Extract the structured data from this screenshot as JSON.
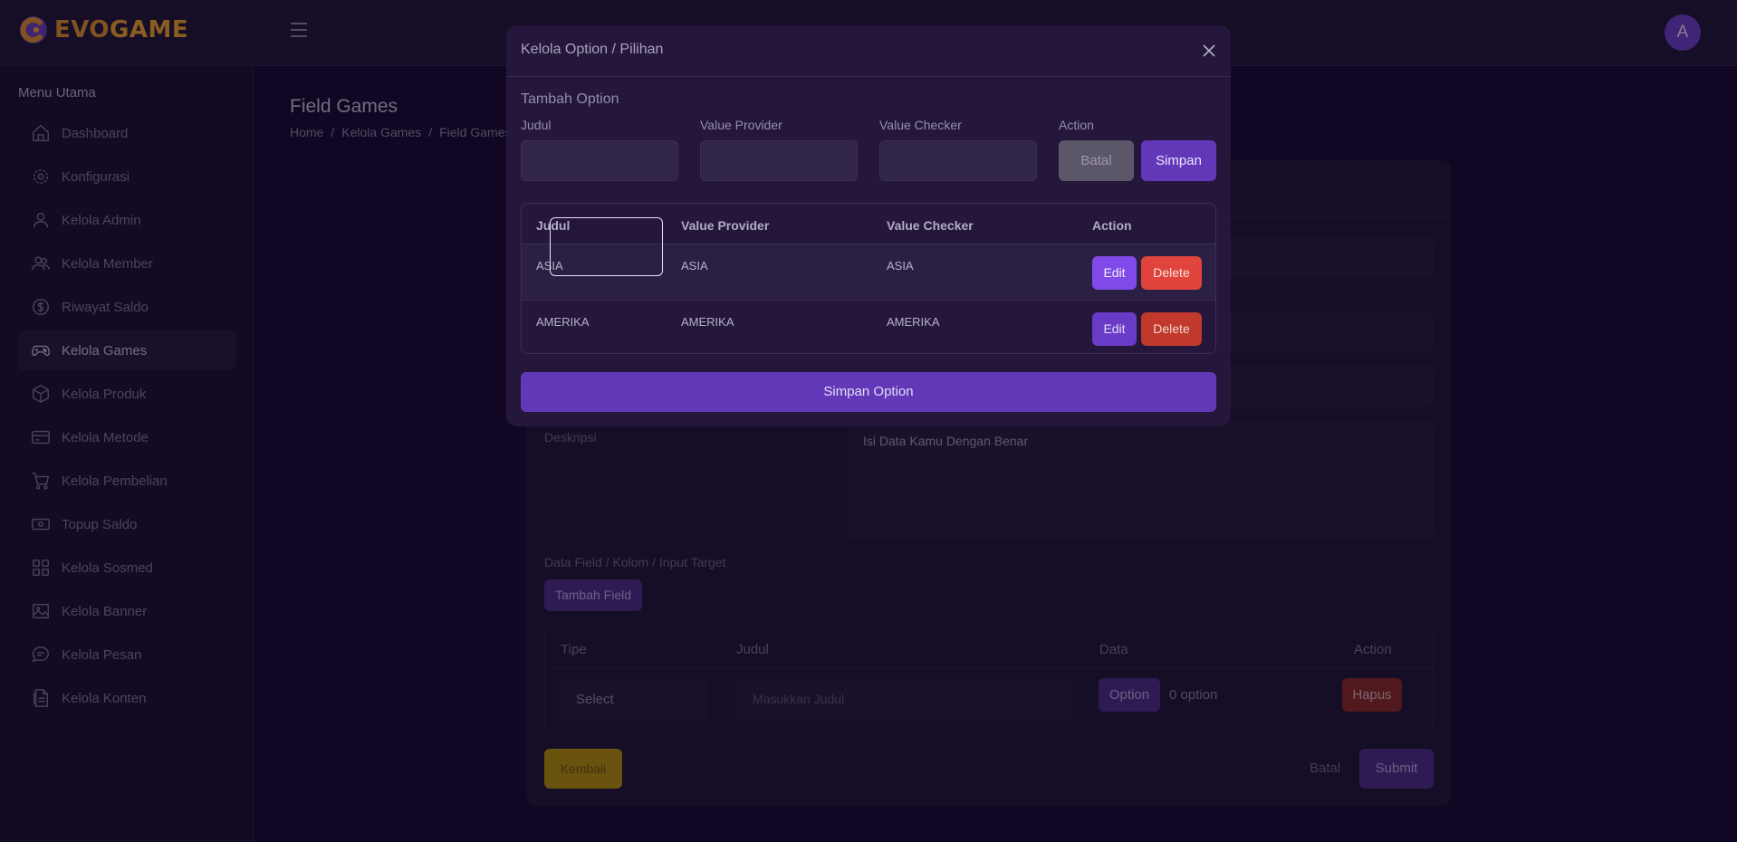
{
  "header": {
    "logo_evo": "EVO",
    "logo_game": "GAME",
    "avatar_initial": "A"
  },
  "sidebar": {
    "title": "Menu Utama",
    "items": [
      {
        "label": "Dashboard",
        "icon": "home-icon"
      },
      {
        "label": "Konfigurasi",
        "icon": "gear-icon"
      },
      {
        "label": "Kelola Admin",
        "icon": "user-icon"
      },
      {
        "label": "Kelola Member",
        "icon": "users-icon"
      },
      {
        "label": "Riwayat Saldo",
        "icon": "dollar-circle-icon"
      },
      {
        "label": "Kelola Games",
        "icon": "gamepad-icon",
        "active": true
      },
      {
        "label": "Kelola Produk",
        "icon": "box-icon"
      },
      {
        "label": "Kelola Metode",
        "icon": "card-icon"
      },
      {
        "label": "Kelola Pembelian",
        "icon": "cart-icon"
      },
      {
        "label": "Topup Saldo",
        "icon": "cash-icon"
      },
      {
        "label": "Kelola Sosmed",
        "icon": "grid-icon"
      },
      {
        "label": "Kelola Banner",
        "icon": "image-icon"
      },
      {
        "label": "Kelola Pesan",
        "icon": "chat-icon"
      },
      {
        "label": "Kelola Konten",
        "icon": "document-icon"
      }
    ]
  },
  "page": {
    "title": "Field Games",
    "breadcrumb": [
      "Home",
      "Kelola Games",
      "Field Games"
    ]
  },
  "form": {
    "deskripsi_label": "Deskripsi",
    "deskripsi_value": "Isi Data Kamu Dengan Benar",
    "data_field_label": "Data Field / Kolom / Input Target",
    "tambah_field": "Tambah Field",
    "table": {
      "headers": [
        "Tipe",
        "Judul",
        "Data",
        "Action"
      ],
      "row": {
        "tipe": "Select",
        "judul_placeholder": "Masukkan Judul",
        "option_btn": "Option",
        "option_count": "0 option",
        "hapus": "Hapus"
      }
    },
    "kembali": "Kembali",
    "batal": "Batal",
    "submit": "Submit"
  },
  "modal": {
    "title": "Kelola Option / Pilihan",
    "subtitle": "Tambah Option",
    "labels": {
      "judul": "Judul",
      "value_provider": "Value Provider",
      "value_checker": "Value Checker",
      "action": "Action"
    },
    "batal": "Batal",
    "simpan": "Simpan",
    "table": {
      "headers": [
        "Judul",
        "Value Provider",
        "Value Checker",
        "Action"
      ],
      "rows": [
        {
          "judul": "ASIA",
          "provider": "ASIA",
          "checker": "ASIA",
          "edit": "Edit",
          "delete": "Delete"
        },
        {
          "judul": "AMERIKA",
          "provider": "AMERIKA",
          "checker": "AMERIKA",
          "edit": "Edit",
          "delete": "Delete"
        }
      ]
    },
    "simpan_option": "Simpan Option"
  },
  "colors": {
    "accent": "#6238b8",
    "danger": "#c0392b",
    "warning": "#b8930a",
    "background": "#170930"
  }
}
